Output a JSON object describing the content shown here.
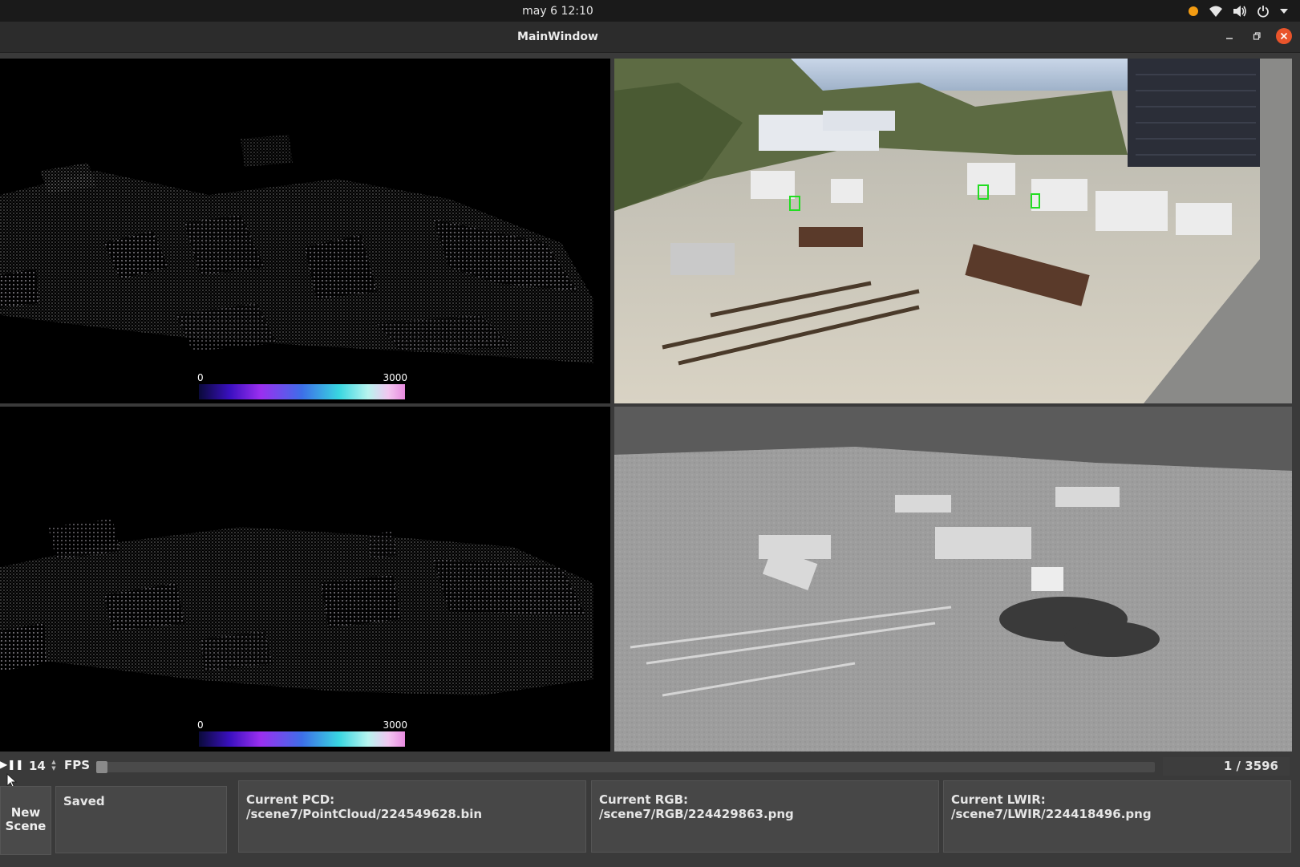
{
  "system_bar": {
    "clock": "may 6  12:10",
    "tray_icons": [
      "notification-dot-icon",
      "wifi-icon",
      "volume-icon",
      "power-icon",
      "chevron-down-icon"
    ]
  },
  "window": {
    "title": "MainWindow",
    "controls": [
      "minimize",
      "restore",
      "close"
    ]
  },
  "panes": {
    "top_left": {
      "type": "lidar-pointcloud",
      "colorbar": {
        "min": "0",
        "max": "3000"
      }
    },
    "bottom_left": {
      "type": "lidar-pointcloud",
      "colorbar": {
        "min": "0",
        "max": "3000"
      }
    },
    "top_right": {
      "type": "rgb-camera",
      "detections": 3
    },
    "bottom_right": {
      "type": "lwir-thermal-camera"
    }
  },
  "playback": {
    "play_pause_icon": "play-pause-icon",
    "fps_value": "14",
    "fps_label": "FPS",
    "progress": 0.0003,
    "counter": "1 / 3596"
  },
  "footer": {
    "new_scene_label": "New\nScene",
    "status": "Saved",
    "pcd": {
      "label": "Current PCD:",
      "path": "/scene7/PointCloud/224549628.bin"
    },
    "rgb": {
      "label": "Current RGB:",
      "path": "/scene7/RGB/224429863.png"
    },
    "lwir": {
      "label": "Current LWIR:",
      "path": "/scene7/LWIR/224418496.png"
    }
  },
  "colors": {
    "accent_close": "#e9542b",
    "tray_notification": "#f39c12",
    "detection_box": "#22dd22"
  }
}
